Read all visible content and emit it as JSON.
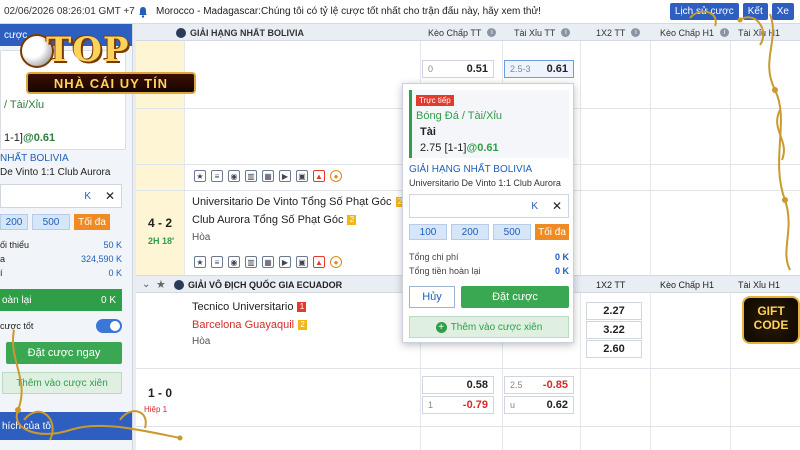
{
  "topbar": {
    "clock": "02/06/2026 08:26:01 GMT +7",
    "marquee": "Morocco - Madagascar:Chúng tôi có tỷ lệ cược tốt nhất cho trận đấu này, hãy xem thử!",
    "buttons": [
      "Lịch sử cược",
      "Kết",
      "Xe"
    ]
  },
  "logo": {
    "top": "TOP",
    "ribbon": "NHÀ CÁI UY TÍN"
  },
  "left_panel": {
    "header": "cược",
    "sport": "/ Tài/Xỉu",
    "odd_line": "1-1]",
    "odd_value": "@0.61",
    "league": "NHẤT BOLIVIA",
    "match": "De Vinto 1:1 Club Aurora",
    "input_k": "K",
    "quick": [
      "200",
      "500"
    ],
    "max_label": "Tối đa",
    "info": [
      {
        "label": "ối thiểu",
        "value": "50 K"
      },
      {
        "label": "a",
        "value": "324,590 K"
      },
      {
        "label": "í",
        "value": "0 K"
      }
    ],
    "refund_label": "oàn lại",
    "refund_value": "0 K",
    "accept_label": "cược tốt",
    "bet_now": "Đặt cược ngay",
    "parlay": "Thêm vào cược xiên",
    "footer": "hích của tôi"
  },
  "header": {
    "league": "GIẢI HẠNG NHẤT BOLIVIA",
    "cols": [
      "Kèo Chấp TT",
      "Tài Xỉu TT",
      "1X2 TT",
      "Kèo Chấp H1",
      "Tài Xỉu H1"
    ]
  },
  "match1": {
    "hdp_line": "0",
    "hdp_odd": "0.51",
    "ou_line": "2.5-3",
    "ou_odd": "0.61"
  },
  "match2": {
    "score": "4 - 2",
    "time": "2H 18'",
    "home": "Universitario De Vinto Tổng Số Phạt Góc",
    "home_tag": "2",
    "away": "Club Aurora Tổng Số Phạt Góc",
    "away_tag": "2",
    "draw": "Hòa"
  },
  "league2": {
    "name": "GIẢI VÔ ĐỊCH QUỐC GIA ECUADOR",
    "cols": [
      "1X2 TT",
      "Kèo Chấp H1",
      "Tài Xỉu H1"
    ]
  },
  "match3": {
    "home": "Tecnico Universitario",
    "home_tag": "1",
    "away": "Barcelona Guayaquil",
    "away_tag": "2",
    "draw": "Hòa",
    "x12": [
      "2.27",
      "3.22",
      "2.60"
    ],
    "score": "1 - 0",
    "time": "Hiệp 1",
    "r1": {
      "hdp": "0.58",
      "ou_line": "2.5",
      "ou": "-0.85"
    },
    "r2": {
      "hdp_line": "1",
      "hdp": "-0.79",
      "ou_line": "u",
      "ou": "0.62"
    }
  },
  "popup": {
    "live": "Trực tiếp",
    "sport": "Bóng Đá / Tài/Xỉu",
    "selection": "Tài",
    "odd_line": "2.75 [1-1]",
    "odd_value": "@0.61",
    "league": "GIẢI HẠNG NHẤT BOLIVIA",
    "match": "Universitario De Vinto 1:1 Club Aurora",
    "input_k": "K",
    "quick": [
      "100",
      "200",
      "500"
    ],
    "max_label": "Tối đa",
    "info": [
      {
        "label": "Tổng chi phí",
        "value": "0 K"
      },
      {
        "label": "Tổng tiền hoàn lại",
        "value": "0 K"
      }
    ],
    "cancel": "Hủy",
    "bet": "Đặt cược",
    "parlay": "Thêm vào cược xiên"
  },
  "gift": {
    "line1": "GIFT",
    "line2": "CODE"
  },
  "colors": {
    "primary": "#2d5ec0",
    "green": "#3aa853",
    "orange": "#f08a24",
    "gold": "#e2b43c"
  }
}
